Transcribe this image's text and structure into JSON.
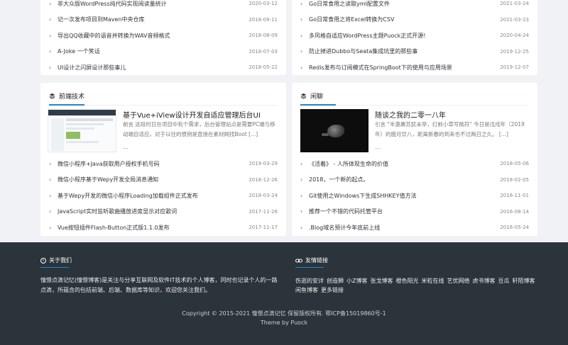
{
  "top_left_list": [
    {
      "title": "非大众版WordPress纯代码实现阅读量统计",
      "date": "2020-03-12"
    },
    {
      "title": "记一次发布项目到Maven中央仓库",
      "date": "2018-09-11"
    },
    {
      "title": "导出QQ收藏中的语音并转换为WAV音频格式",
      "date": "2018-08-09"
    },
    {
      "title": "A-Joke 一个笑话",
      "date": "2018-07-03"
    },
    {
      "title": "UI设计之闪屏设计那些事儿",
      "date": "2018-05-22"
    }
  ],
  "top_right_list": [
    {
      "title": "Go日常食用之读取yml配置文件",
      "date": "2021-03-24"
    },
    {
      "title": "Go日常食用之将Excel转换为CSV",
      "date": "2021-03-23"
    },
    {
      "title": "多风格自适应WordPress主题Puock正式开源!",
      "date": "2020-04-24"
    },
    {
      "title": "防止掉进Dubbo与Seata集成坑里的那些事",
      "date": "2019-12-25"
    },
    {
      "title": "Redis发布与订阅模式在SpringBoot下的使用与应用场景",
      "date": "2019-12-07"
    }
  ],
  "frontend": {
    "heading": "前端技术",
    "featured_title": "基于Vue+iView设计开发自适应管理后台UI",
    "featured_summary": "前言 这段时日在项目中有个需求，后台管理站点是需要PC端与移动端自适应，对于以往的惯例是直接在素材网找Boot [...]",
    "featured_more": "...",
    "items": [
      {
        "title": "微信小程序+Java获取用户授权手机号码",
        "date": "2019-03-29"
      },
      {
        "title": "微信小程序基于Wepy开发全局消息通知",
        "date": "2018-12-26"
      },
      {
        "title": "基于Wepy开发的微信小程序Loading加载组件正式发布",
        "date": "2018-03-24"
      },
      {
        "title": "JavaScript实时监听歌曲播放进度显示对应歌词",
        "date": "2017-11-26"
      },
      {
        "title": "Vue按钮插件Flash-Button正式版1.1.0发布",
        "date": "2017-11-17"
      }
    ]
  },
  "chat": {
    "heading": "闲聊",
    "featured_title": "随谈之我的二零一八年",
    "featured_summary": "引言 \"半盏屠苏犹未举，灯前小草写桃符\" 今日是戊戌年（2019年）的腊月廿八，距离新春的到来也不过两日之久。 [...]",
    "featured_more": "...",
    "items": [
      {
        "title": "《活着》 - 人所体现生命的价值",
        "date": "2018-05-06"
      },
      {
        "title": "2018，一个新的起点。",
        "date": "2018-02-05"
      },
      {
        "title": "Git使用之Windows下生成SHHKEY值方法",
        "date": "2016-11-01"
      },
      {
        "title": "推荐一个不错的代码托管平台",
        "date": "2016-08-14"
      },
      {
        "title": ".Blog域名预计今年底前上线",
        "date": "2016-05-24"
      }
    ]
  },
  "footer": {
    "about_heading": "关于我们",
    "about_text": "憧憬点滴记忆(憧憬博客)是关注与分享互联网及软件IT技术的个人博客，同时也记录个人的一路点滴，所蕴含的包括前端、后端、数据库等知识，欢迎您关注我们。",
    "links_heading": "友情链接",
    "links": [
      "伤逝的安详",
      "创造狮",
      "小Z博客",
      "张戈博客",
      "橙色阳光",
      "米粒在线",
      "艺优网络",
      "虎书博客",
      "豆瓜",
      "轩陌博客",
      "闲鱼博客",
      "更多链接"
    ],
    "copyright": "Copyright © 2015-2021 憧憬点滴记忆  保留版权所有. 鄂ICP备15019860号-1",
    "theme": "Theme by Puock"
  }
}
